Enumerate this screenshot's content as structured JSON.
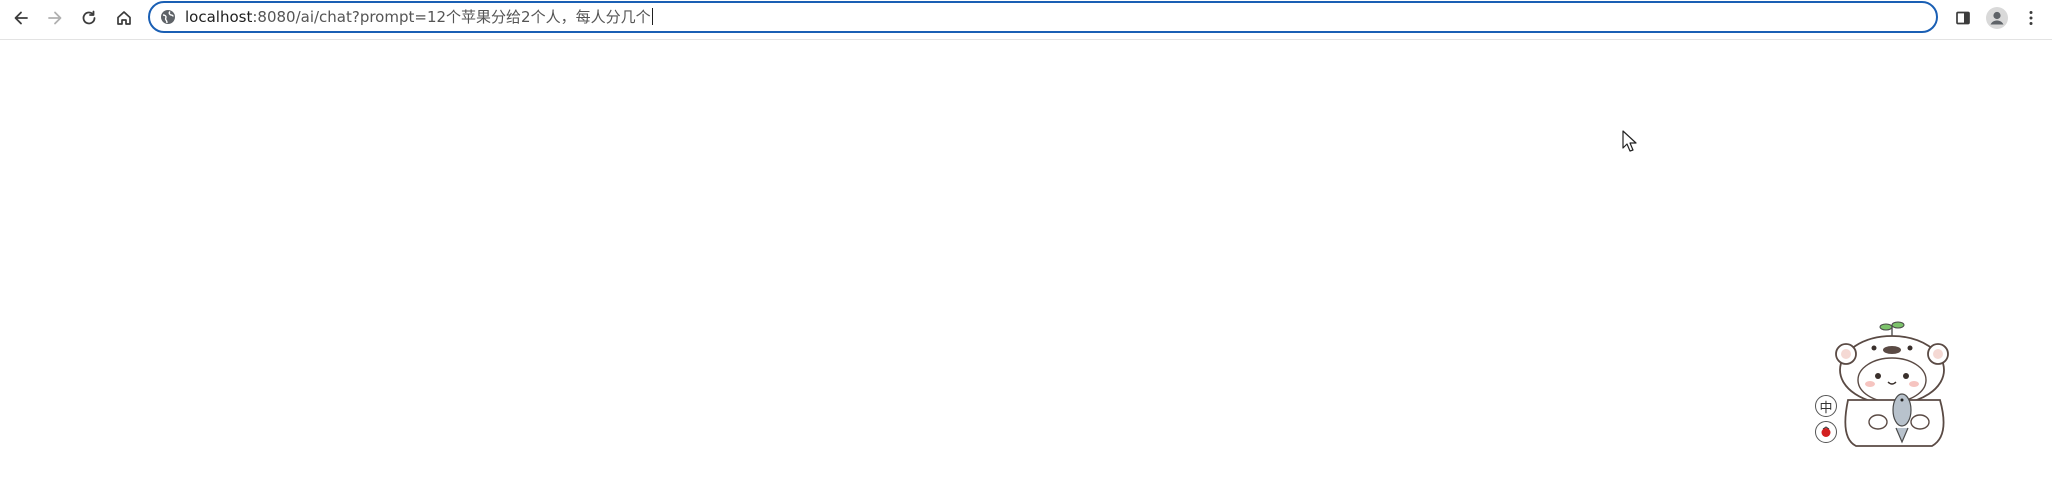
{
  "toolbar": {
    "back_icon": "arrow-left-icon",
    "forward_icon": "arrow-right-icon",
    "reload_icon": "reload-icon",
    "home_icon": "home-icon",
    "sidepanel_icon": "side-panel-icon",
    "profile_icon": "profile-avatar-icon",
    "menu_icon": "kebab-menu-icon"
  },
  "omnibox": {
    "site_icon": "site-info-icon",
    "url_host": "localhost",
    "url_path": ":8080/ai/chat?prompt=12个苹果分给2个人，每人分几个",
    "focused": true,
    "focus_color": "#1a5fb4"
  },
  "widget": {
    "lang_button": "中",
    "mascot_icon": "bear-mascot-icon",
    "record_icon": "record-icon"
  }
}
